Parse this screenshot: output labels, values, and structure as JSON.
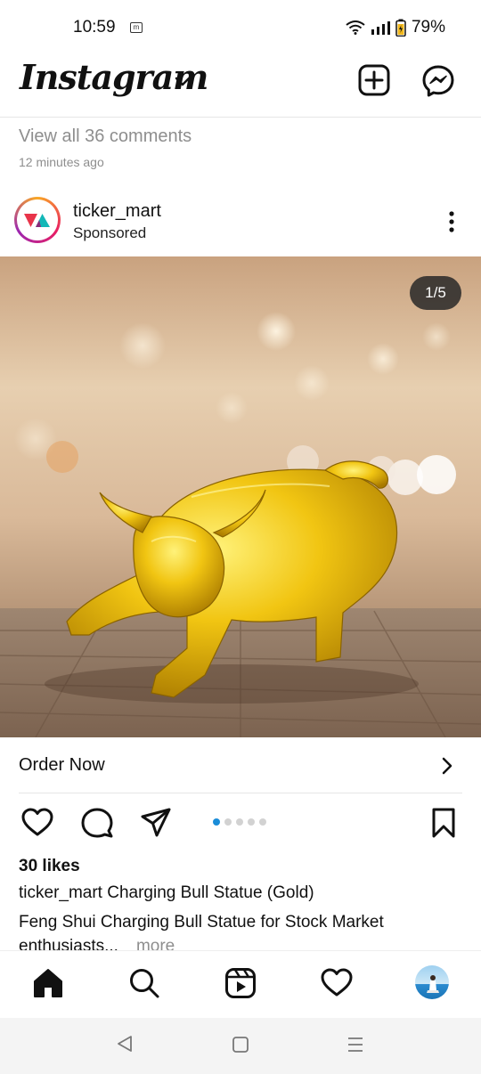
{
  "status_bar": {
    "time": "10:59",
    "notification_icon": "m",
    "battery": "79%"
  },
  "header": {
    "logo": "Instagram"
  },
  "previous_post": {
    "view_comments": "View all 36 comments",
    "time_ago": "12 minutes ago"
  },
  "post": {
    "account": "ticker_mart",
    "sponsored": "Sponsored",
    "image_counter": "1/5",
    "cta": "Order Now",
    "carousel": {
      "total": 5,
      "active": 1
    },
    "likes": "30 likes",
    "caption_user": "ticker_mart",
    "caption_title": "Charging Bull Statue (Gold)",
    "caption_line2": "Feng Shui Charging Bull Statue for Stock Market",
    "caption_line3": "enthusiasts...",
    "more": "more"
  },
  "icons": [
    "new-post-icon",
    "messenger-icon",
    "heart-icon",
    "comment-icon",
    "share-icon",
    "bookmark-icon",
    "home-icon",
    "search-icon",
    "reels-icon",
    "activity-icon",
    "profile-avatar"
  ],
  "colors": {
    "accent": "#1a8cd8",
    "muted": "#8e8e8e",
    "text": "#111111"
  }
}
